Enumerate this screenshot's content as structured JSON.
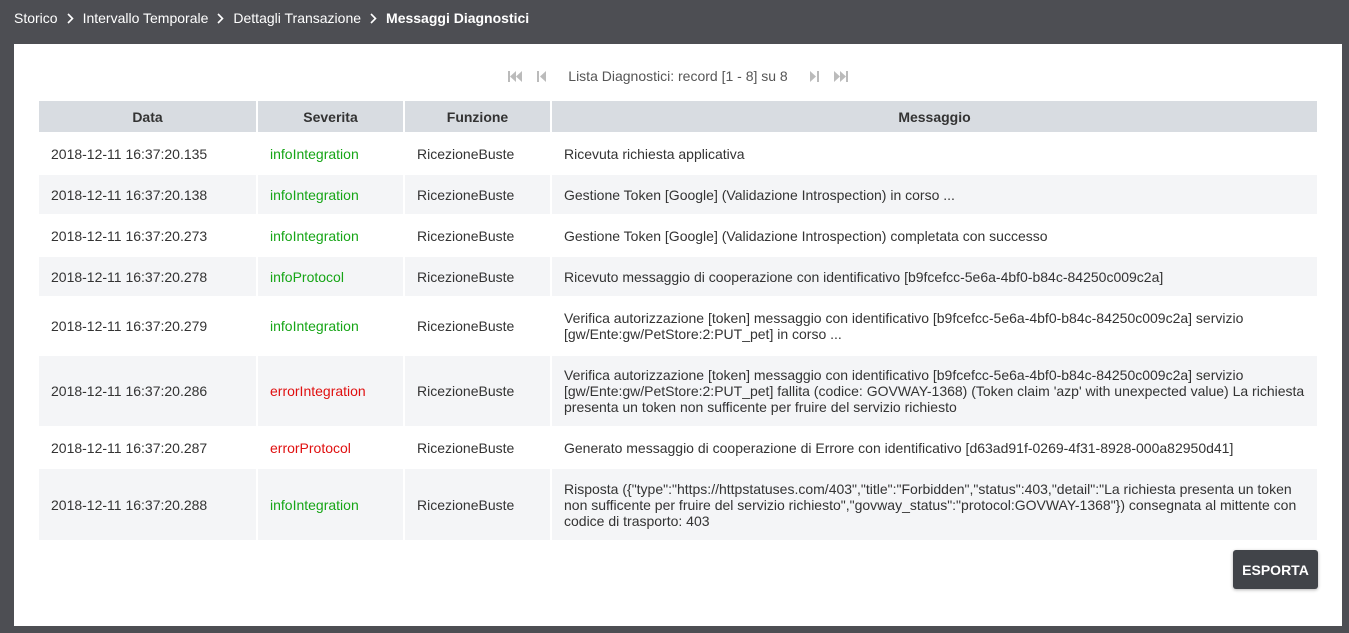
{
  "breadcrumb": {
    "items": [
      "Storico",
      "Intervallo Temporale",
      "Dettagli Transazione"
    ],
    "current": "Messaggi Diagnostici"
  },
  "pager": {
    "text": "Lista Diagnostici: record [1 - 8] su 8"
  },
  "table": {
    "headers": {
      "data": "Data",
      "severita": "Severita",
      "funzione": "Funzione",
      "messaggio": "Messaggio"
    },
    "rows": [
      {
        "data": "2018-12-11 16:37:20.135",
        "severita": "infoIntegration",
        "funzione": "RicezioneBuste",
        "messaggio": "Ricevuta richiesta applicativa"
      },
      {
        "data": "2018-12-11 16:37:20.138",
        "severita": "infoIntegration",
        "funzione": "RicezioneBuste",
        "messaggio": "Gestione Token [Google] (Validazione Introspection) in corso ..."
      },
      {
        "data": "2018-12-11 16:37:20.273",
        "severita": "infoIntegration",
        "funzione": "RicezioneBuste",
        "messaggio": "Gestione Token [Google] (Validazione Introspection) completata con successo"
      },
      {
        "data": "2018-12-11 16:37:20.278",
        "severita": "infoProtocol",
        "funzione": "RicezioneBuste",
        "messaggio": "Ricevuto messaggio di cooperazione con identificativo [b9fcefcc-5e6a-4bf0-b84c-84250c009c2a]"
      },
      {
        "data": "2018-12-11 16:37:20.279",
        "severita": "infoIntegration",
        "funzione": "RicezioneBuste",
        "messaggio": "Verifica autorizzazione [token] messaggio con identificativo [b9fcefcc-5e6a-4bf0-b84c-84250c009c2a] servizio [gw/Ente:gw/PetStore:2:PUT_pet] in corso ..."
      },
      {
        "data": "2018-12-11 16:37:20.286",
        "severita": "errorIntegration",
        "funzione": "RicezioneBuste",
        "messaggio": "Verifica autorizzazione [token] messaggio con identificativo [b9fcefcc-5e6a-4bf0-b84c-84250c009c2a] servizio [gw/Ente:gw/PetStore:2:PUT_pet] fallita (codice: GOVWAY-1368) (Token claim 'azp' with unexpected value) La richiesta presenta un token non sufficente per fruire del servizio richiesto"
      },
      {
        "data": "2018-12-11 16:37:20.287",
        "severita": "errorProtocol",
        "funzione": "RicezioneBuste",
        "messaggio": "Generato messaggio di cooperazione di Errore con identificativo [d63ad91f-0269-4f31-8928-000a82950d41]"
      },
      {
        "data": "2018-12-11 16:37:20.288",
        "severita": "infoIntegration",
        "funzione": "RicezioneBuste",
        "messaggio": "Risposta ({\"type\":\"https://httpstatuses.com/403\",\"title\":\"Forbidden\",\"status\":403,\"detail\":\"La richiesta presenta un token non sufficente per fruire del servizio richiesto\",\"govway_status\":\"protocol:GOVWAY-1368\"}) consegnata al mittente con codice di trasporto: 403"
      }
    ]
  },
  "export_label": "ESPORTA",
  "colors": {
    "info": "#16a516",
    "error": "#e01010",
    "header_bg": "#d8dce1",
    "page_bg": "#4d4e53"
  }
}
